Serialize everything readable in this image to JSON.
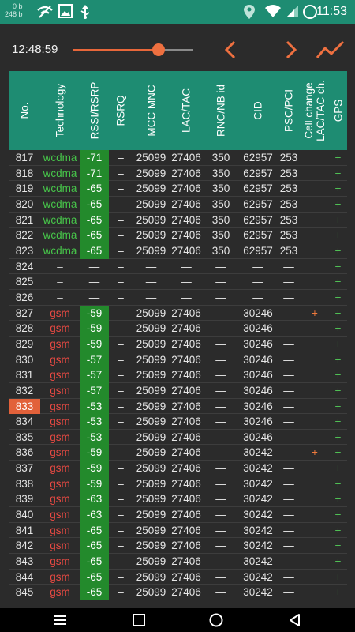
{
  "status": {
    "net_down": "0 b",
    "net_up": "248 b",
    "time": "11:53"
  },
  "toolbar": {
    "clock": "12:48:59",
    "slider_value": 0.71
  },
  "colors": {
    "accent": "#1e8c72",
    "signal": "#238a2c",
    "wcdma": "#47c64a",
    "gsm": "#ea4a43",
    "highlight": "#e2613a",
    "orange": "#ee7040"
  },
  "headers": [
    "No.",
    "Technology",
    "RSSI/RSRP",
    "RSRQ",
    "MCC MNC",
    "LAC/TAC",
    "RNC/NB id",
    "CID",
    "PSC/PCI",
    "Cell change\nLAC/TAC ch.",
    "GPS"
  ],
  "rows": [
    {
      "no": "817",
      "tech": "wcdma",
      "rssi": "-71",
      "rsrq": "–",
      "mccmnc": "25099",
      "lac": "27406",
      "rnc": "350",
      "cid": "62957",
      "psc": "253",
      "cc": "",
      "gps": "+"
    },
    {
      "no": "818",
      "tech": "wcdma",
      "rssi": "-71",
      "rsrq": "–",
      "mccmnc": "25099",
      "lac": "27406",
      "rnc": "350",
      "cid": "62957",
      "psc": "253",
      "cc": "",
      "gps": "+"
    },
    {
      "no": "819",
      "tech": "wcdma",
      "rssi": "-65",
      "rsrq": "–",
      "mccmnc": "25099",
      "lac": "27406",
      "rnc": "350",
      "cid": "62957",
      "psc": "253",
      "cc": "",
      "gps": "+"
    },
    {
      "no": "820",
      "tech": "wcdma",
      "rssi": "-65",
      "rsrq": "–",
      "mccmnc": "25099",
      "lac": "27406",
      "rnc": "350",
      "cid": "62957",
      "psc": "253",
      "cc": "",
      "gps": "+"
    },
    {
      "no": "821",
      "tech": "wcdma",
      "rssi": "-65",
      "rsrq": "–",
      "mccmnc": "25099",
      "lac": "27406",
      "rnc": "350",
      "cid": "62957",
      "psc": "253",
      "cc": "",
      "gps": "+"
    },
    {
      "no": "822",
      "tech": "wcdma",
      "rssi": "-65",
      "rsrq": "–",
      "mccmnc": "25099",
      "lac": "27406",
      "rnc": "350",
      "cid": "62957",
      "psc": "253",
      "cc": "",
      "gps": "+"
    },
    {
      "no": "823",
      "tech": "wcdma",
      "rssi": "-65",
      "rsrq": "–",
      "mccmnc": "25099",
      "lac": "27406",
      "rnc": "350",
      "cid": "62957",
      "psc": "253",
      "cc": "",
      "gps": "+"
    },
    {
      "no": "824",
      "tech": "–",
      "rssi": "—",
      "rsrq": "–",
      "mccmnc": "—",
      "lac": "—",
      "rnc": "—",
      "cid": "—",
      "psc": "—",
      "cc": "",
      "gps": "+"
    },
    {
      "no": "825",
      "tech": "–",
      "rssi": "—",
      "rsrq": "–",
      "mccmnc": "—",
      "lac": "—",
      "rnc": "—",
      "cid": "—",
      "psc": "—",
      "cc": "",
      "gps": "+"
    },
    {
      "no": "826",
      "tech": "–",
      "rssi": "—",
      "rsrq": "–",
      "mccmnc": "—",
      "lac": "—",
      "rnc": "—",
      "cid": "—",
      "psc": "—",
      "cc": "",
      "gps": "+"
    },
    {
      "no": "827",
      "tech": "gsm",
      "rssi": "-59",
      "rsrq": "–",
      "mccmnc": "25099",
      "lac": "27406",
      "rnc": "—",
      "cid": "30246",
      "psc": "—",
      "cc": "+",
      "gps": "+"
    },
    {
      "no": "828",
      "tech": "gsm",
      "rssi": "-59",
      "rsrq": "–",
      "mccmnc": "25099",
      "lac": "27406",
      "rnc": "—",
      "cid": "30246",
      "psc": "—",
      "cc": "",
      "gps": "+"
    },
    {
      "no": "829",
      "tech": "gsm",
      "rssi": "-59",
      "rsrq": "–",
      "mccmnc": "25099",
      "lac": "27406",
      "rnc": "—",
      "cid": "30246",
      "psc": "—",
      "cc": "",
      "gps": "+"
    },
    {
      "no": "830",
      "tech": "gsm",
      "rssi": "-57",
      "rsrq": "–",
      "mccmnc": "25099",
      "lac": "27406",
      "rnc": "—",
      "cid": "30246",
      "psc": "—",
      "cc": "",
      "gps": "+"
    },
    {
      "no": "831",
      "tech": "gsm",
      "rssi": "-57",
      "rsrq": "–",
      "mccmnc": "25099",
      "lac": "27406",
      "rnc": "—",
      "cid": "30246",
      "psc": "—",
      "cc": "",
      "gps": "+"
    },
    {
      "no": "832",
      "tech": "gsm",
      "rssi": "-57",
      "rsrq": "–",
      "mccmnc": "25099",
      "lac": "27406",
      "rnc": "—",
      "cid": "30246",
      "psc": "—",
      "cc": "",
      "gps": "+"
    },
    {
      "no": "833",
      "tech": "gsm",
      "rssi": "-53",
      "rsrq": "–",
      "mccmnc": "25099",
      "lac": "27406",
      "rnc": "—",
      "cid": "30246",
      "psc": "—",
      "cc": "",
      "gps": "+",
      "highlight": true
    },
    {
      "no": "834",
      "tech": "gsm",
      "rssi": "-53",
      "rsrq": "–",
      "mccmnc": "25099",
      "lac": "27406",
      "rnc": "—",
      "cid": "30246",
      "psc": "—",
      "cc": "",
      "gps": "+"
    },
    {
      "no": "835",
      "tech": "gsm",
      "rssi": "-53",
      "rsrq": "–",
      "mccmnc": "25099",
      "lac": "27406",
      "rnc": "—",
      "cid": "30246",
      "psc": "—",
      "cc": "",
      "gps": "+"
    },
    {
      "no": "836",
      "tech": "gsm",
      "rssi": "-59",
      "rsrq": "–",
      "mccmnc": "25099",
      "lac": "27406",
      "rnc": "—",
      "cid": "30242",
      "psc": "—",
      "cc": "+",
      "gps": "+"
    },
    {
      "no": "837",
      "tech": "gsm",
      "rssi": "-59",
      "rsrq": "–",
      "mccmnc": "25099",
      "lac": "27406",
      "rnc": "—",
      "cid": "30242",
      "psc": "—",
      "cc": "",
      "gps": "+"
    },
    {
      "no": "838",
      "tech": "gsm",
      "rssi": "-59",
      "rsrq": "–",
      "mccmnc": "25099",
      "lac": "27406",
      "rnc": "—",
      "cid": "30242",
      "psc": "—",
      "cc": "",
      "gps": "+"
    },
    {
      "no": "839",
      "tech": "gsm",
      "rssi": "-63",
      "rsrq": "–",
      "mccmnc": "25099",
      "lac": "27406",
      "rnc": "—",
      "cid": "30242",
      "psc": "—",
      "cc": "",
      "gps": "+"
    },
    {
      "no": "840",
      "tech": "gsm",
      "rssi": "-63",
      "rsrq": "–",
      "mccmnc": "25099",
      "lac": "27406",
      "rnc": "—",
      "cid": "30242",
      "psc": "—",
      "cc": "",
      "gps": "+"
    },
    {
      "no": "841",
      "tech": "gsm",
      "rssi": "-65",
      "rsrq": "–",
      "mccmnc": "25099",
      "lac": "27406",
      "rnc": "—",
      "cid": "30242",
      "psc": "—",
      "cc": "",
      "gps": "+"
    },
    {
      "no": "842",
      "tech": "gsm",
      "rssi": "-65",
      "rsrq": "–",
      "mccmnc": "25099",
      "lac": "27406",
      "rnc": "—",
      "cid": "30242",
      "psc": "—",
      "cc": "",
      "gps": "+"
    },
    {
      "no": "843",
      "tech": "gsm",
      "rssi": "-65",
      "rsrq": "–",
      "mccmnc": "25099",
      "lac": "27406",
      "rnc": "—",
      "cid": "30242",
      "psc": "—",
      "cc": "",
      "gps": "+"
    },
    {
      "no": "844",
      "tech": "gsm",
      "rssi": "-65",
      "rsrq": "–",
      "mccmnc": "25099",
      "lac": "27406",
      "rnc": "—",
      "cid": "30242",
      "psc": "—",
      "cc": "",
      "gps": "+"
    },
    {
      "no": "845",
      "tech": "gsm",
      "rssi": "-65",
      "rsrq": "–",
      "mccmnc": "25099",
      "lac": "27406",
      "rnc": "—",
      "cid": "30242",
      "psc": "—",
      "cc": "",
      "gps": "+"
    }
  ],
  "icons": {
    "status": [
      "mute-icon",
      "image-icon",
      "usb-icon",
      "location-icon",
      "wifi-icon",
      "signal-icon",
      "circle-icon"
    ],
    "toolbar": [
      "chevron-left-icon",
      "chevron-right-icon",
      "chart-line-icon"
    ],
    "nav": [
      "menu-icon",
      "recents-icon",
      "home-icon",
      "back-icon"
    ]
  }
}
